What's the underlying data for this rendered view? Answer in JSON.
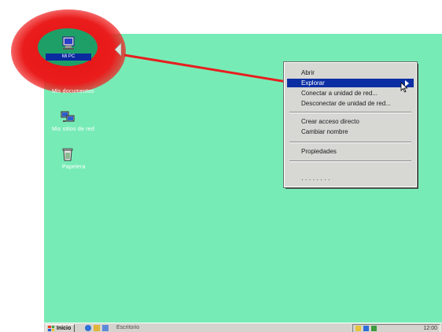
{
  "desktop": {
    "background_color": "#77ebb6",
    "highlight_color": "#e51414",
    "icons": [
      {
        "label": "Mi PC",
        "icon": "my-computer-icon",
        "selected": true
      },
      {
        "label": "Mis documentos",
        "icon": "my-documents-icon"
      },
      {
        "label": "Mis sitios de red",
        "icon": "network-icon"
      },
      {
        "label": "Papelera",
        "icon": "recycle-bin-icon"
      }
    ]
  },
  "context_menu": {
    "active_color": "#0b2ea3",
    "items": [
      {
        "label": "Abrir",
        "active": false
      },
      {
        "label": "Explorar",
        "active": true,
        "submenu": true
      },
      {
        "label": "Conectar a unidad de red...",
        "active": false
      },
      {
        "label": "Desconectar de unidad de red...",
        "active": false
      },
      {
        "label": "Crear acceso directo",
        "active": false
      },
      {
        "label": "Cambiar nombre",
        "active": false
      },
      {
        "label": "Propiedades",
        "active": false
      }
    ]
  },
  "taskbar": {
    "start_label": "Inicio",
    "task_text": "Escritorio",
    "tray_icons": [
      "speaker-icon",
      "network-tray-icon",
      "shield-icon"
    ],
    "clock": "12:00"
  }
}
